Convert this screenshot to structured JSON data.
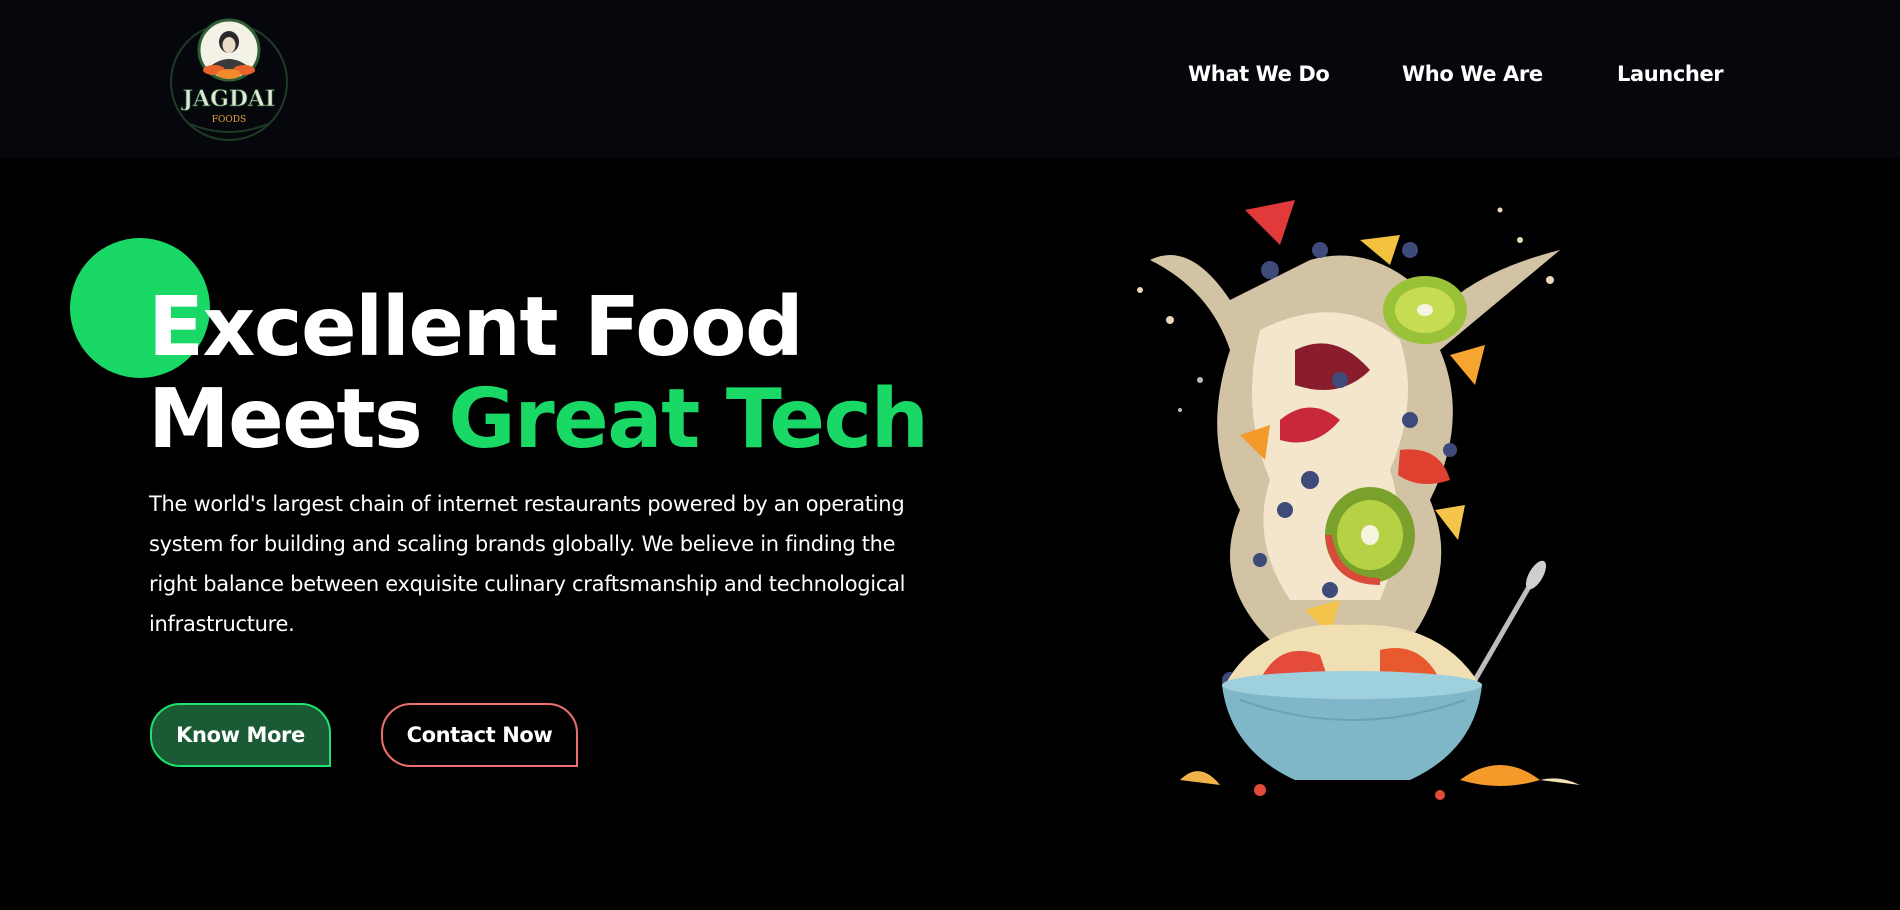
{
  "brand": {
    "name": "JAGDAI",
    "tagline": "FOODS",
    "logo_icon": "chef-portrait-logo"
  },
  "nav": {
    "items": [
      {
        "label": "What We Do"
      },
      {
        "label": "Who We Are"
      },
      {
        "label": "Launcher"
      }
    ]
  },
  "hero": {
    "headline_line1": "Excellent Food",
    "headline_line2_white": "Meets ",
    "headline_line2_green": "Great Tech",
    "description": "The world's largest chain of internet restaurants powered by an operating system for building and scaling brands globally. We believe in finding the right balance between exquisite culinary craftsmanship and technological infrastructure.",
    "buttons": {
      "know_more": "Know More",
      "contact_now": "Contact Now"
    },
    "image_icon": "fruit-bowl-splash-image"
  },
  "colors": {
    "background": "#000000",
    "header_bg": "#05070c",
    "accent_green": "#19d866",
    "know_more_bg": "#1a5a34",
    "contact_border": "#ef6f6f",
    "text": "#ffffff"
  }
}
